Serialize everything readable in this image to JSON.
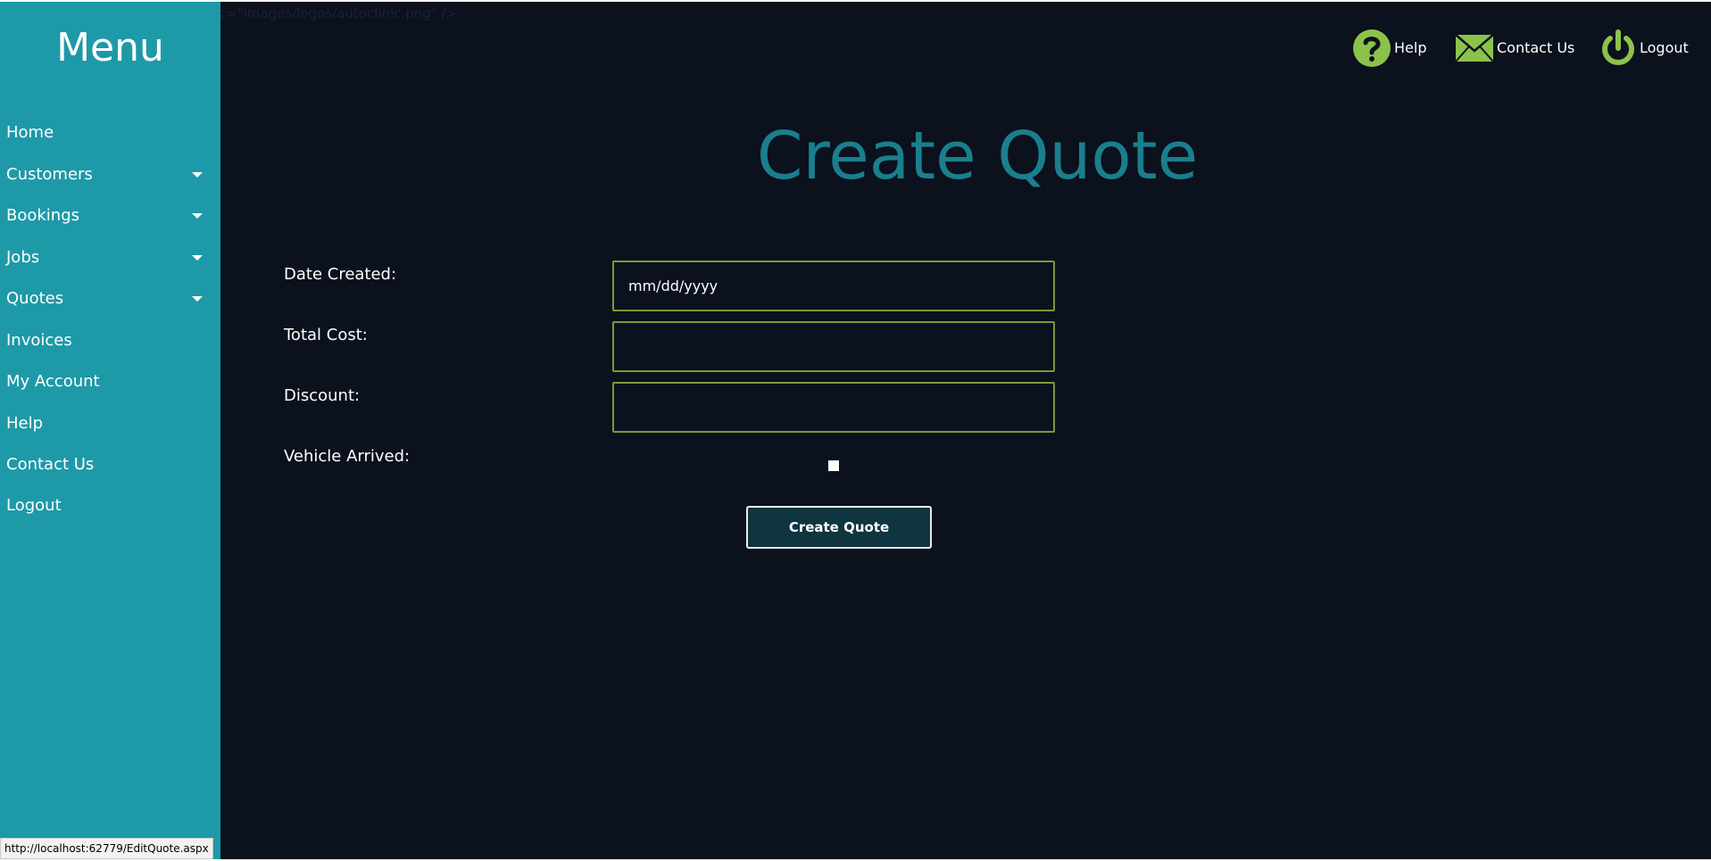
{
  "ghost_text": "c=\"images/logos/autoclinic.png\" />",
  "sidebar": {
    "title": "Menu",
    "items": [
      {
        "label": "Home",
        "has_submenu": false
      },
      {
        "label": "Customers",
        "has_submenu": true
      },
      {
        "label": "Bookings",
        "has_submenu": true
      },
      {
        "label": "Jobs",
        "has_submenu": true
      },
      {
        "label": "Quotes",
        "has_submenu": true
      },
      {
        "label": "Invoices",
        "has_submenu": false
      },
      {
        "label": "My Account",
        "has_submenu": false
      },
      {
        "label": "Help",
        "has_submenu": false
      },
      {
        "label": "Contact Us",
        "has_submenu": false
      },
      {
        "label": "Logout",
        "has_submenu": false
      }
    ]
  },
  "header": {
    "help_label": "Help",
    "contact_label": "Contact Us",
    "logout_label": "Logout"
  },
  "page": {
    "title": "Create Quote"
  },
  "form": {
    "date_created_label": "Date Created:",
    "date_created_placeholder": "mm/dd/yyyy",
    "total_cost_label": "Total Cost:",
    "total_cost_value": "",
    "discount_label": "Discount:",
    "discount_value": "",
    "vehicle_arrived_label": "Vehicle Arrived:",
    "submit_label": "Create Quote"
  },
  "status_bar": {
    "url": "http://localhost:62779/EditQuote.aspx"
  },
  "colors": {
    "sidebar_bg": "#1e99a8",
    "page_bg": "#0b111d",
    "title_color": "#1a7f8d",
    "icon_green": "#8bc34a",
    "input_border": "#7a9a3a",
    "button_bg": "#0f3540"
  }
}
